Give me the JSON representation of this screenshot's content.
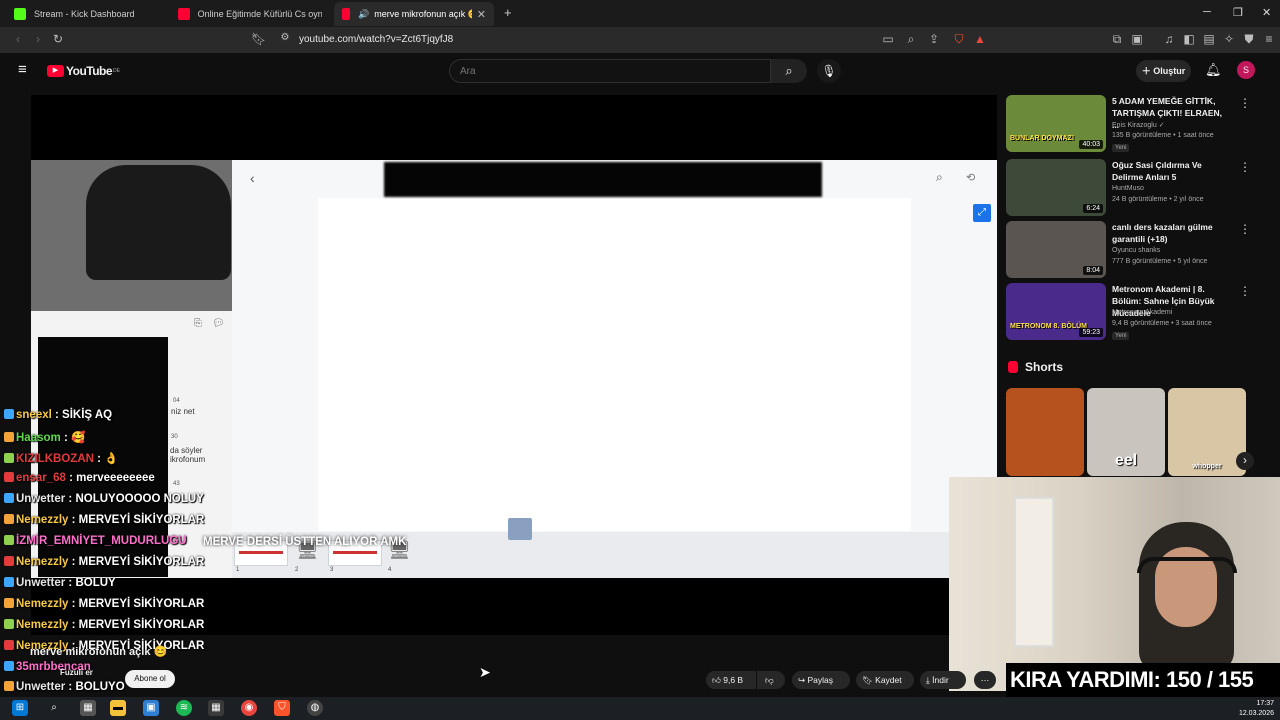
{
  "browser": {
    "tabs": [
      {
        "title": "Stream - Kick Dashboard",
        "fav_color": "#53fc18"
      },
      {
        "title": "Online Eğitimde Küfürlü Cs oynayan",
        "fav_color": "#ff0033"
      },
      {
        "title": "merve mikrofonun açık 😊 - Y",
        "fav_color": "#ff0033"
      }
    ],
    "new_tab": "+",
    "url": "youtube.com/watch?v=Zct6TjqyfJ8"
  },
  "youtube": {
    "logo": "YouTube",
    "logo_region": "DE",
    "search_placeholder": "Ara",
    "create_label": "Oluştur",
    "avatar_letter": "S",
    "channel_name": "Fuzuli",
    "channel_suffix": "er",
    "video_title": "merve mikrofonun açık 😊",
    "subscribe_label": "Abone ol",
    "likes": "9,6 B",
    "share_label": "Paylaş",
    "save_label": "Kaydet",
    "download_label": "İndir"
  },
  "player": {
    "overlay_text": "MERVE DERSİ ÜSTTEN ALIYOR AMK",
    "thumb_numbers": [
      "1",
      "2",
      "3",
      "4"
    ],
    "chat_snippet": [
      "04",
      "niz net",
      "30",
      "da söyler",
      "ikrofonum",
      "43"
    ]
  },
  "stream_chat": [
    {
      "user": "sneexl",
      "msg": "SİKİŞ AQ",
      "color": "u-yel"
    },
    {
      "user": "Haasom",
      "msg": "🥰",
      "color": "u-green"
    },
    {
      "user": "KIZILKBOZAN",
      "msg": "👌",
      "color": "u-red"
    },
    {
      "user": "ensar_68",
      "msg": "merveeeeeeee",
      "color": "u-red"
    },
    {
      "user": "Unwetter",
      "msg": "NOLUYOOOOO NOLUY",
      "color": "u-grey"
    },
    {
      "user": "Nemezzly",
      "msg": "MERVEYİ SİKİYORLAR",
      "color": "u-yel"
    },
    {
      "user": "İZMİR_EMNİYET_MUDURLUGU",
      "msg": "",
      "color": "u-pink"
    },
    {
      "user": "Nemezzly",
      "msg": "MERVEYİ SİKİYORLAR",
      "color": "u-yel"
    },
    {
      "user": "Unwetter",
      "msg": "BOLUY",
      "color": "u-grey"
    },
    {
      "user": "Nemezzly",
      "msg": "MERVEYİ SİKİYORLAR",
      "color": "u-yel"
    },
    {
      "user": "Nemezzly",
      "msg": "MERVEYİ SİKİYORLAR",
      "color": "u-yel"
    },
    {
      "user": "Nemezzly",
      "msg": "MERVEYİ SİKİYORLAR",
      "color": "u-yel"
    },
    {
      "user": "35mrbbencan",
      "msg": "",
      "color": "u-pink"
    },
    {
      "user": "Unwetter",
      "msg": "BOLUYO",
      "color": "u-grey"
    },
    {
      "user": "sneexl",
      "msg": "",
      "color": "u-yel"
    }
  ],
  "sidebar": {
    "videos": [
      {
        "title": "5 ADAM YEMEĞE GİTTİK, TARTIŞMA ÇIKTI! ELRAEN, ...",
        "channel": "Enis Kirazoglu ✓",
        "meta": "135 B görüntüleme • 1 saat önce",
        "badge": "Yeni",
        "duration": "40:03",
        "thumb_caption": "BUNLAR DOYMAZ!",
        "thumb_color": "#6b8a3a"
      },
      {
        "title": "Oğuz Sasi Çıldırma Ve Delirme Anları 5",
        "channel": "HuntMuso",
        "meta": "24 B görüntüleme • 2 yıl önce",
        "badge": "",
        "duration": "6:24",
        "thumb_caption": "",
        "thumb_color": "#3d4a3a"
      },
      {
        "title": "canlı ders kazaları gülme garantili (+18)",
        "channel": "Oyuncu shanks",
        "meta": "777 B görüntüleme • 5 yıl önce",
        "badge": "",
        "duration": "8:04",
        "thumb_caption": "",
        "thumb_color": "#5a5550"
      },
      {
        "title": "Metronom Akademi | 8. Bölüm: Sahne İçin Büyük Mücadele",
        "channel": "Metronom Akademi",
        "meta": "9,4 B görüntüleme • 3 saat önce",
        "badge": "Yeni",
        "duration": "59:23",
        "thumb_caption": "METRONOM 8. BÖLÜM",
        "thumb_color": "#4a2a8a"
      }
    ],
    "shorts_label": "Shorts",
    "shorts": [
      {
        "caption": "",
        "color": "#b5521e"
      },
      {
        "caption": "eel",
        "color": "#c9c4bd"
      },
      {
        "caption": "whopper",
        "color": "#d8c6a5"
      }
    ]
  },
  "stream_overlay": {
    "kira_label": "KIRA YARDIMI:",
    "kira_value": "150 / 155"
  },
  "taskbar": {
    "time": "17:37",
    "date": "12.03.2026"
  }
}
